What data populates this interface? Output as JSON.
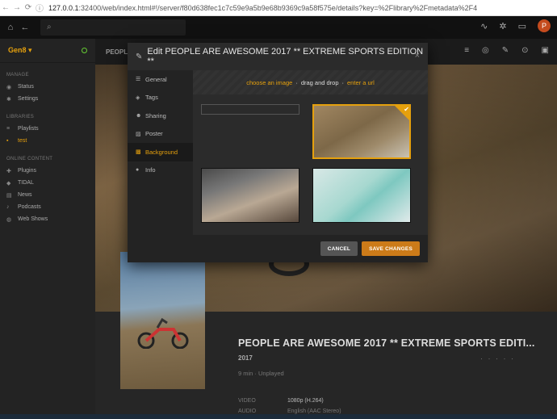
{
  "browser": {
    "url_host": "127.0.0.1",
    "url_rest": ":32400/web/index.html#!/server/f80d638fec1c7c59e9a5b9e68b9369c9a58f575e/details?key=%2Flibrary%2Fmetadata%2F4"
  },
  "topbar": {
    "search_placeholder": "",
    "avatar_letter": "P"
  },
  "sidebar": {
    "server_name": "Gen8 ▾",
    "manage_label": "MANAGE",
    "manage_items": [
      {
        "label": "Status"
      },
      {
        "label": "Settings"
      }
    ],
    "libraries_label": "LIBRARIES",
    "library_items": [
      {
        "label": "Playlists"
      },
      {
        "label": "test"
      }
    ],
    "online_label": "ONLINE CONTENT",
    "online_items": [
      {
        "label": "Plugins"
      },
      {
        "label": "TIDAL"
      },
      {
        "label": "News"
      },
      {
        "label": "Podcasts"
      },
      {
        "label": "Web Shows"
      }
    ]
  },
  "toolbar": {
    "crumb": "PEOPLE"
  },
  "modal": {
    "title": "Edit PEOPLE ARE AWESOME 2017 ** EXTREME SPORTS EDITION **",
    "close": "×",
    "tabs": [
      {
        "label": "General"
      },
      {
        "label": "Tags"
      },
      {
        "label": "Sharing"
      },
      {
        "label": "Poster"
      },
      {
        "label": "Background"
      },
      {
        "label": "Info"
      }
    ],
    "drop": {
      "choose": "choose an image",
      "sep1": "·",
      "drag": "drag and drop",
      "sep2": "·",
      "url": "enter a url"
    },
    "cancel": "CANCEL",
    "save": "SAVE CHANGES"
  },
  "details": {
    "title": "PEOPLE ARE AWESOME 2017 ** EXTREME SPORTS EDITI...",
    "year": "2017",
    "dots": "· · · · ·",
    "meta": "9 min  ·  Unplayed",
    "video_label": "VIDEO",
    "video_value": "1080p (H.264)",
    "audio_label": "AUDIO",
    "audio_value": "English (AAC Stereo)"
  }
}
